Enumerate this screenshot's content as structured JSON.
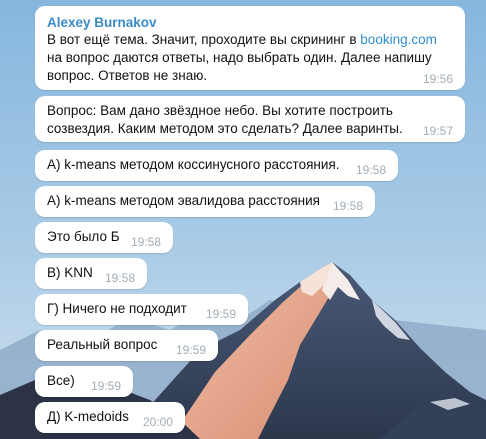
{
  "colors": {
    "sky_top": "#8fbce0",
    "sky_bottom": "#c9dcea",
    "mountain_dark": "#3b4a63",
    "mountain_lit": "#e8a58c",
    "snow": "#f4ece8",
    "bubble": "#ffffff",
    "sender": "#3a8bc7",
    "link": "#2f8ed1",
    "timestamp": "#a2adb4"
  },
  "messages": [
    {
      "sender": "Alexey Burnakov",
      "line1_prefix": "В вот ещё тема. Значит, проходите вы скрининг в ",
      "link": "booking.com",
      "line2": "на вопрос даются ответы, надо выбрать один. Далее напишу",
      "line3": "вопрос. Ответов не знаю.",
      "time": "19:56"
    },
    {
      "line1": "Вопрос: Вам дано звёздное небо. Вы хотите построить",
      "line2": "созвездия. Каким методом это сделать? Далее варинты.",
      "time": "19:57"
    },
    {
      "text": "A) k-means методом коссинусного расстояния.",
      "time": "19:58"
    },
    {
      "text": "A) k-means методом эвалидова расстояния",
      "time": "19:58"
    },
    {
      "text": "Это было Б",
      "time": "19:58"
    },
    {
      "text": "B) KNN",
      "time": "19:58"
    },
    {
      "text": "Г) Ничего не подходит",
      "time": "19:59"
    },
    {
      "text": "Реальный вопрос",
      "time": "19:59"
    },
    {
      "text": "Все)",
      "time": "19:59"
    },
    {
      "text": "Д) K-medoids",
      "time": "20:00"
    }
  ]
}
